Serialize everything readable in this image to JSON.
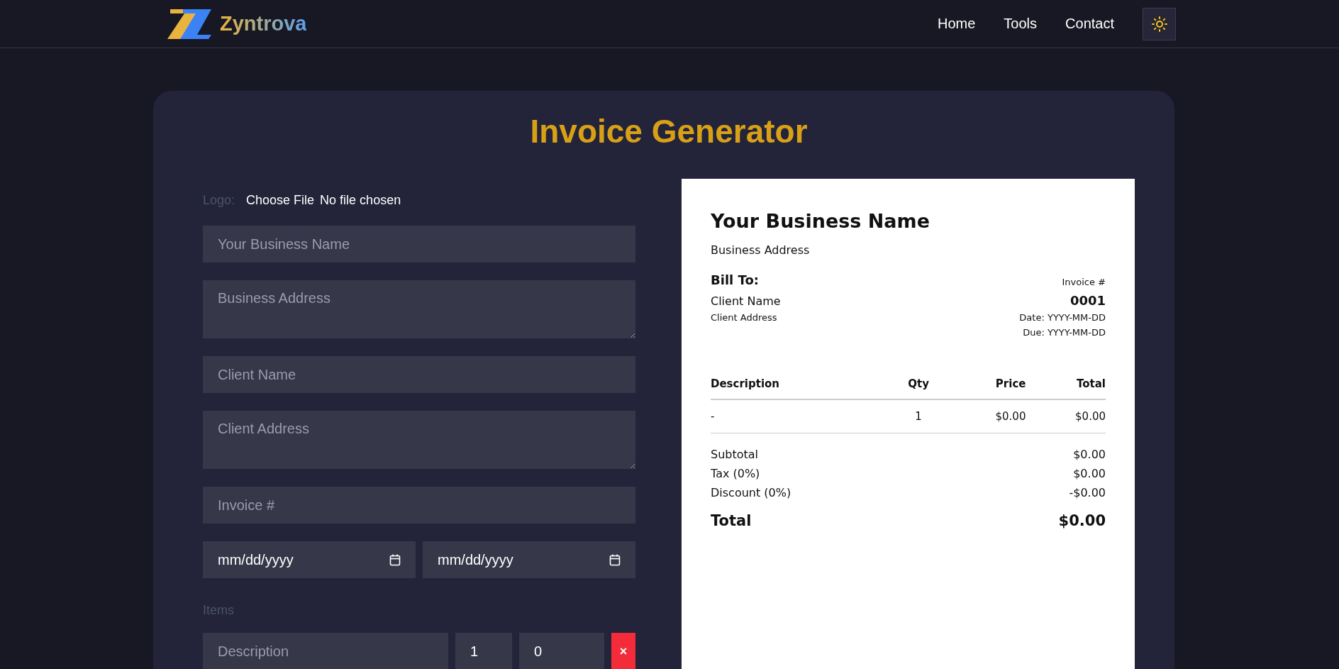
{
  "header": {
    "brand": "Zyntrova",
    "nav": [
      {
        "label": "Home"
      },
      {
        "label": "Tools"
      },
      {
        "label": "Contact"
      }
    ]
  },
  "title": "Invoice Generator",
  "form": {
    "logo_label": "Logo:",
    "file_button": "Choose File",
    "file_status": "No file chosen",
    "fields": [
      {
        "kind": "input",
        "placeholder": "Your Business Name"
      },
      {
        "kind": "textarea",
        "placeholder": "Business Address"
      },
      {
        "kind": "input",
        "placeholder": "Client Name"
      },
      {
        "kind": "textarea",
        "placeholder": "Client Address"
      },
      {
        "kind": "input",
        "placeholder": "Invoice #"
      }
    ],
    "dates": [
      {
        "value": "mm/dd/yyyy"
      },
      {
        "value": "mm/dd/yyyy"
      }
    ],
    "items_label": "Items",
    "item": {
      "description_placeholder": "Description",
      "qty": "1",
      "price": "0",
      "delete": "×"
    }
  },
  "preview": {
    "business_name": "Your Business Name",
    "business_address": "Business Address",
    "bill_to": "Bill To:",
    "client_name": "Client Name",
    "client_address": "Client Address",
    "invoice_label": "Invoice #",
    "invoice_number": "0001",
    "date": "Date: YYYY-MM-DD",
    "due": "Due: YYYY-MM-DD",
    "table": {
      "columns": [
        "Description",
        "Qty",
        "Price",
        "Total"
      ],
      "rows": [
        [
          "-",
          "1",
          "$0.00",
          "$0.00"
        ]
      ]
    },
    "summary": [
      {
        "label": "Subtotal",
        "value": "$0.00"
      },
      {
        "label": "Tax (0%)",
        "value": "$0.00"
      },
      {
        "label": "Discount (0%)",
        "value": "-$0.00"
      }
    ],
    "total": {
      "label": "Total",
      "value": "$0.00"
    }
  }
}
